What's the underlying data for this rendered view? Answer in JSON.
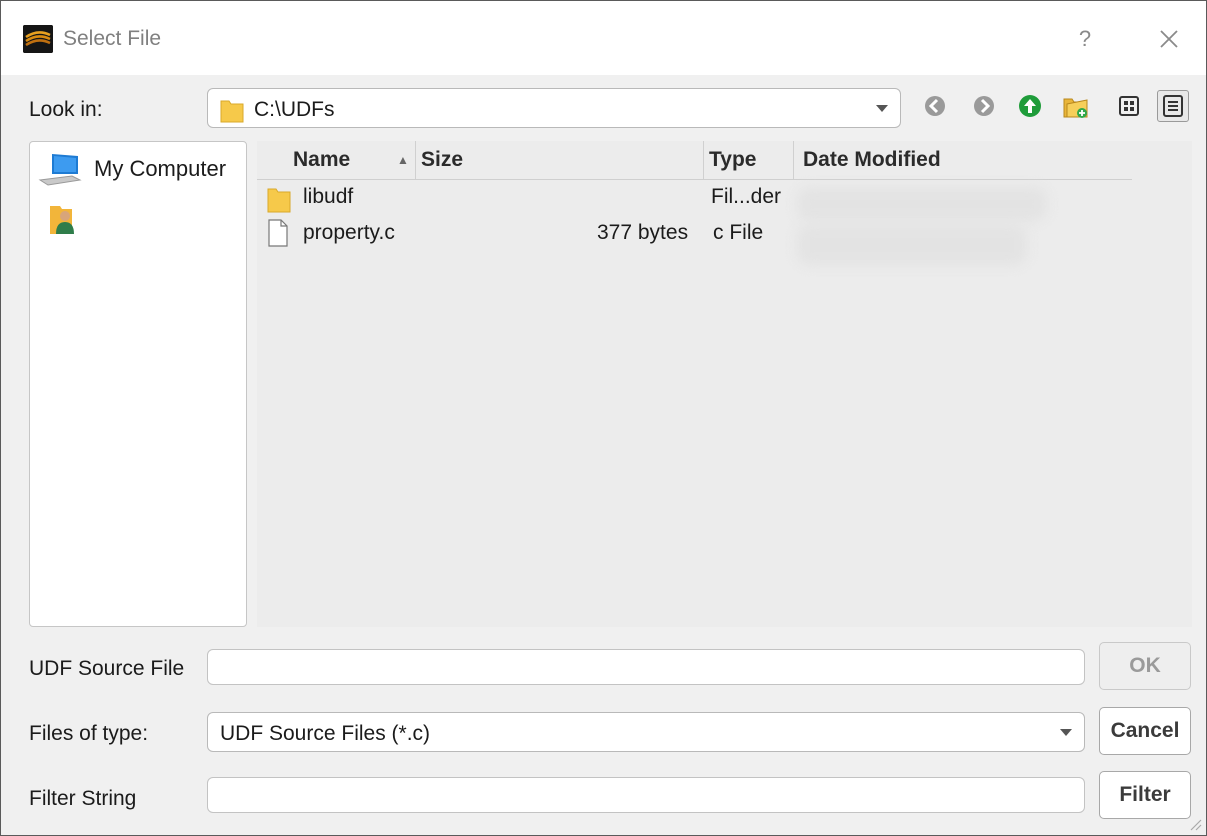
{
  "window": {
    "title": "Select File",
    "help_label": "?",
    "close_label": "✕"
  },
  "lookin": {
    "label": "Look in:",
    "path": "C:\\UDFs"
  },
  "toolbar": {
    "back_icon": "back-arrow-icon",
    "forward_icon": "forward-arrow-icon",
    "up_icon": "up-arrow-icon",
    "new_folder_icon": "new-folder-icon",
    "list_view_icon": "list-view-icon",
    "detail_view_icon": "detail-view-icon"
  },
  "sidebar": {
    "items": [
      {
        "label": "My Computer",
        "icon": "computer-icon"
      },
      {
        "label": "",
        "icon": "user-folder-icon"
      }
    ]
  },
  "files": {
    "columns": [
      "Name",
      "Size",
      "Type",
      "Date Modified"
    ],
    "sort_indicator": "▲",
    "rows": [
      {
        "name": "libudf",
        "size": "",
        "type": "Fil...der",
        "icon": "folder-icon"
      },
      {
        "name": "property.c",
        "size": "377 bytes",
        "type": "c File",
        "icon": "file-icon"
      }
    ]
  },
  "source_file": {
    "label": "UDF Source File",
    "value": ""
  },
  "file_type": {
    "label": "Files of type:",
    "selected": "UDF Source Files (*.c)"
  },
  "filter": {
    "label": "Filter String",
    "value": ""
  },
  "buttons": {
    "ok": "OK",
    "cancel": "Cancel",
    "filter": "Filter"
  },
  "colors": {
    "folder": "#f6c94a",
    "up_arrow": "#1f9c3a",
    "computer_blue": "#1e7bd3"
  }
}
